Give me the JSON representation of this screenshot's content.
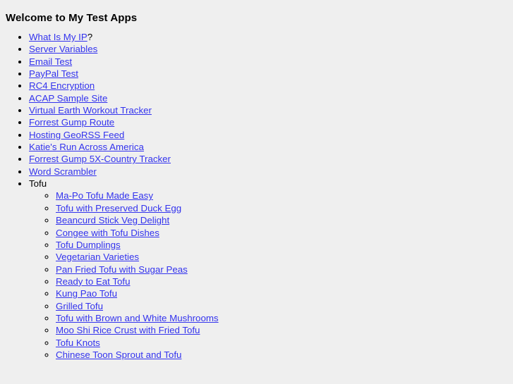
{
  "page": {
    "background_color": "#efefef",
    "link_color": "#3333ee",
    "text_color": "#000000",
    "title": "Welcome to My Test Apps"
  },
  "apps": [
    {
      "label": "What Is My IP",
      "is_link": true,
      "suffix": "?"
    },
    {
      "label": "Server Variables",
      "is_link": true,
      "suffix": ""
    },
    {
      "label": "Email Test",
      "is_link": true,
      "suffix": ""
    },
    {
      "label": "PayPal Test",
      "is_link": true,
      "suffix": ""
    },
    {
      "label": "RC4 Encryption",
      "is_link": true,
      "suffix": ""
    },
    {
      "label": "ACAP Sample Site",
      "is_link": true,
      "suffix": ""
    },
    {
      "label": "Virtual Earth Workout Tracker",
      "is_link": true,
      "suffix": ""
    },
    {
      "label": "Forrest Gump Route",
      "is_link": true,
      "suffix": ""
    },
    {
      "label": "Hosting GeoRSS Feed",
      "is_link": true,
      "suffix": ""
    },
    {
      "label": "Katie's Run Across America",
      "is_link": true,
      "suffix": ""
    },
    {
      "label": "Forrest Gump 5X-Country Tracker",
      "is_link": true,
      "suffix": ""
    },
    {
      "label": "Word Scrambler",
      "is_link": true,
      "suffix": ""
    },
    {
      "label": "Tofu",
      "is_link": false,
      "suffix": ""
    }
  ],
  "tofu_recipes": [
    {
      "label": "Ma-Po Tofu Made Easy"
    },
    {
      "label": "Tofu with Preserved Duck Egg"
    },
    {
      "label": "Beancurd Stick Veg Delight"
    },
    {
      "label": "Congee with Tofu Dishes"
    },
    {
      "label": "Tofu Dumplings"
    },
    {
      "label": "Vegetarian Varieties"
    },
    {
      "label": "Pan Fried Tofu with Sugar Peas"
    },
    {
      "label": "Ready to Eat Tofu"
    },
    {
      "label": "Kung Pao Tofu"
    },
    {
      "label": "Grilled Tofu"
    },
    {
      "label": "Tofu with Brown and White Mushrooms"
    },
    {
      "label": "Moo Shi Rice Crust with Fried Tofu"
    },
    {
      "label": "Tofu Knots"
    },
    {
      "label": "Chinese Toon Sprout and Tofu"
    }
  ]
}
